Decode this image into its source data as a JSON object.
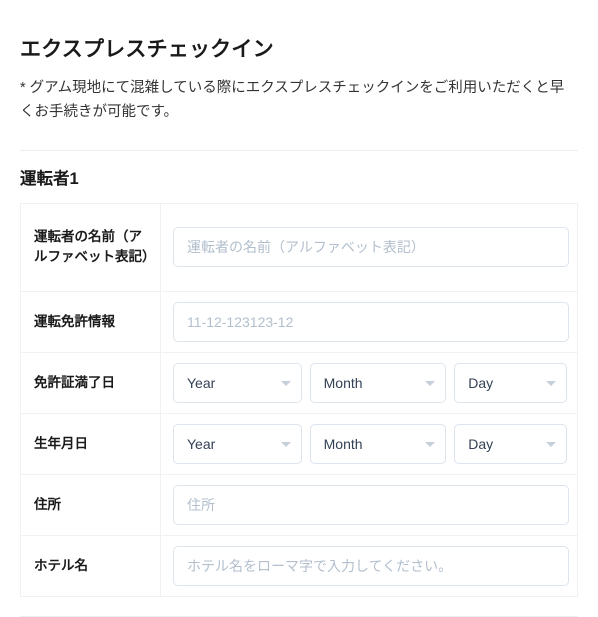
{
  "header": {
    "title": "エクスプレスチェックイン",
    "note": "* グアム現地にて混雑している際にエクスプレスチェックインをご利用いただくと早くお手続きが可能です。"
  },
  "driver_section": {
    "title": "運転者1",
    "rows": [
      {
        "label": "運転者の名前（アルファベット表記）",
        "type": "text",
        "value": "",
        "placeholder": "運転者の名前（アルファベット表記）"
      },
      {
        "label": "運転免許情報",
        "type": "text",
        "value": "",
        "placeholder": "11-12-123123-12"
      },
      {
        "label": "免許証満了日",
        "type": "date",
        "year": "Year",
        "month": "Month",
        "day": "Day"
      },
      {
        "label": "生年月日",
        "type": "date",
        "year": "Year",
        "month": "Month",
        "day": "Day"
      },
      {
        "label": "住所",
        "type": "text",
        "value": "",
        "placeholder": "住所"
      },
      {
        "label": "ホテル名",
        "type": "text",
        "value": "",
        "placeholder": "ホテル名をローマ字で入力してください。"
      }
    ]
  },
  "icons": {
    "dropdown": "chevron-down-icon"
  },
  "colors": {
    "text": "#1a1a1a",
    "note_text": "#333333",
    "placeholder": "#b3bfcd",
    "input_border": "#dde4ec",
    "table_border": "#f1f1f1",
    "divider": "#eeeeee",
    "select_text": "#334155"
  }
}
